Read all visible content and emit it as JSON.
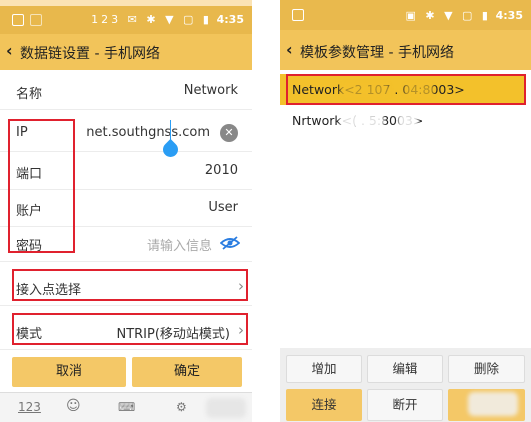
{
  "left": {
    "status_time": "4:35",
    "status_icons": "123 ✉ ✱ ▼ ▢ ▮",
    "title": "数据链设置 - 手机网络",
    "rows": {
      "name": {
        "label": "名称",
        "value": "Network"
      },
      "ip": {
        "label": "IP",
        "value": "net.southgnss.com"
      },
      "port": {
        "label": "端口",
        "value": "2010"
      },
      "account": {
        "label": "账户",
        "value": "User"
      },
      "password": {
        "label": "密码",
        "placeholder": "请输入信息"
      },
      "access_point": {
        "label": "接入点选择"
      },
      "mode": {
        "label": "模式",
        "value": "NTRIP(移动站模式)"
      }
    },
    "buttons": {
      "cancel": "取消",
      "confirm": "确定"
    },
    "keyboard": {
      "numeric": "123"
    }
  },
  "right": {
    "status_time": "4:35",
    "status_icons": "▣ ✱ ▼ ▢ ▮",
    "title": "模板参数管理 - 手机网络",
    "items": [
      {
        "text": "Network<2    107 .    04:8003>"
      },
      {
        "text": "Nrtwork<(        .    5:8003>"
      }
    ],
    "buttons": {
      "add": "增加",
      "edit": "编辑",
      "delete": "删除",
      "connect": "连接",
      "disconnect": "断开",
      "third": "登录"
    }
  },
  "colors": {
    "title_bar": "#f2c45a",
    "status_bar": "#e8b84c",
    "highlight_box": "#e0212e",
    "button": "#f4c867",
    "selected_item": "#f3c12b"
  }
}
